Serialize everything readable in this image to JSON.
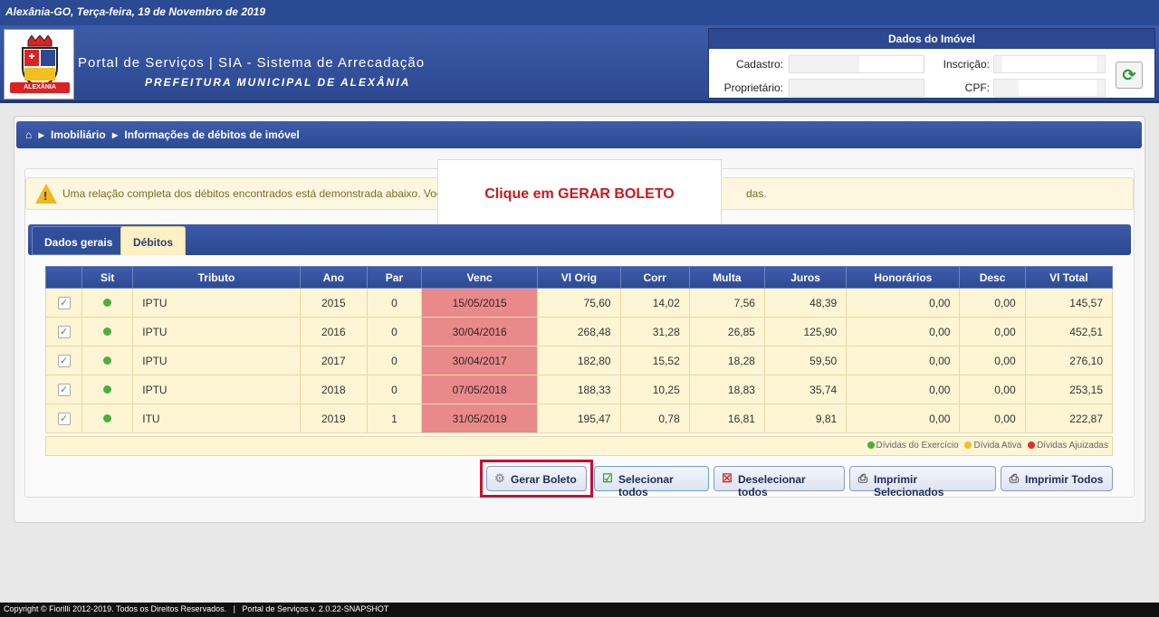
{
  "topbar": {
    "location_date": "Alexânia-GO, Terça-feira, 19 de Novembro de 2019"
  },
  "header": {
    "title": "Portal de Serviços | SIA - Sistema de Arrecadação",
    "subtitle": "PREFEITURA MUNICIPAL DE ALEXÂNIA",
    "logo_text": "ALEXÂNIA"
  },
  "imovel": {
    "title": "Dados do Imóvel",
    "cadastro_label": "Cadastro:",
    "inscricao_label": "Inscrição:",
    "proprietario_label": "Proprietário:",
    "cpf_label": "CPF:",
    "refresh_icon": "refresh-icon"
  },
  "breadcrumb": {
    "home_icon": "home-icon",
    "item1": "Imobiliário",
    "item2": "Informações de débitos de imóvel"
  },
  "alert": {
    "text": "Uma relação completa dos débitos encontrados está demonstrada abaixo. Voc",
    "tail": "das."
  },
  "callout": {
    "text": "Clique em GERAR BOLETO"
  },
  "tabs": [
    {
      "label": "Dados gerais"
    },
    {
      "label": "Débitos"
    }
  ],
  "table": {
    "columns": [
      "",
      "Sit",
      "Tributo",
      "Ano",
      "Par",
      "Venc",
      "Vl Orig",
      "Corr",
      "Multa",
      "Juros",
      "Honorários",
      "Desc",
      "Vl Total"
    ],
    "rows": [
      {
        "tributo": "IPTU",
        "ano": "2015",
        "par": "0",
        "venc": "15/05/2015",
        "orig": "75,60",
        "corr": "14,02",
        "multa": "7,56",
        "juros": "48,39",
        "hon": "0,00",
        "desc": "0,00",
        "total": "145,57"
      },
      {
        "tributo": "IPTU",
        "ano": "2016",
        "par": "0",
        "venc": "30/04/2016",
        "orig": "268,48",
        "corr": "31,28",
        "multa": "26,85",
        "juros": "125,90",
        "hon": "0,00",
        "desc": "0,00",
        "total": "452,51"
      },
      {
        "tributo": "IPTU",
        "ano": "2017",
        "par": "0",
        "venc": "30/04/2017",
        "orig": "182,80",
        "corr": "15,52",
        "multa": "18,28",
        "juros": "59,50",
        "hon": "0,00",
        "desc": "0,00",
        "total": "276,10"
      },
      {
        "tributo": "IPTU",
        "ano": "2018",
        "par": "0",
        "venc": "07/05/2018",
        "orig": "188,33",
        "corr": "10,25",
        "multa": "18,83",
        "juros": "35,74",
        "hon": "0,00",
        "desc": "0,00",
        "total": "253,15"
      },
      {
        "tributo": "ITU",
        "ano": "2019",
        "par": "1",
        "venc": "31/05/2019",
        "orig": "195,47",
        "corr": "0,78",
        "multa": "16,81",
        "juros": "9,81",
        "hon": "0,00",
        "desc": "0,00",
        "total": "222,87"
      }
    ]
  },
  "legend": {
    "exercicio": "Dívidas do Exercício",
    "ativa": "Dívida Ativa",
    "ajuizadas": "Dívidas Ajuizadas",
    "colors": {
      "exercicio": "#4caf3a",
      "ativa": "#f0c020",
      "ajuizadas": "#e03030"
    }
  },
  "buttons": {
    "gerar": "Gerar Boleto",
    "selecionar": "Selecionar todos",
    "deselecionar": "Deselecionar todos",
    "imprimir_sel": "Imprimir Selecionados",
    "imprimir_todos": "Imprimir Todos"
  },
  "footer": {
    "text": "Copyright © Fiorilli 2012-2019. Todos os Direitos Reservados.   |   Portal de Serviços v. 2.0.22-SNAPSHOT"
  }
}
